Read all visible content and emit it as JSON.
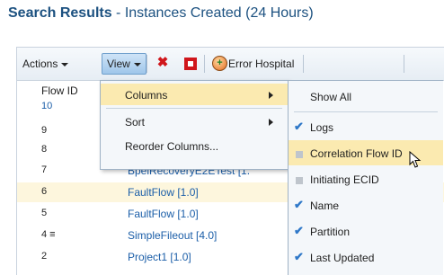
{
  "page": {
    "title_bold": "Search Results",
    "title_rest": " - Instances Created (24 Hours)"
  },
  "toolbar": {
    "actions_label": "Actions",
    "view_label": "View",
    "error_hospital_label": "Error Hospital"
  },
  "table": {
    "flow_id_header": "Flow ID",
    "rows": [
      {
        "id": "10",
        "name": ""
      },
      {
        "id": "9",
        "name": ""
      },
      {
        "id": "8",
        "name": ""
      },
      {
        "id": "7",
        "name": "BpelRecoveryE2ETest [1."
      },
      {
        "id": "6",
        "name": "FaultFlow [1.0]"
      },
      {
        "id": "5",
        "name": "FaultFlow [1.0]"
      },
      {
        "id": "4 ≡",
        "name": "SimpleFileout [4.0]"
      },
      {
        "id": "2",
        "name": "Project1 [1.0]"
      }
    ]
  },
  "view_menu": {
    "items": [
      {
        "label": "Columns",
        "has_submenu": true,
        "active": true
      },
      {
        "label": "Sort",
        "has_submenu": true,
        "active": false
      },
      {
        "label": "Reorder Columns...",
        "has_submenu": false,
        "active": false
      }
    ]
  },
  "columns_submenu": {
    "items": [
      {
        "label": "Show All",
        "checked": null
      },
      {
        "label": "Logs",
        "checked": true
      },
      {
        "label": "Correlation Flow ID",
        "checked": false
      },
      {
        "label": "Initiating ECID",
        "checked": false
      },
      {
        "label": "Name",
        "checked": true
      },
      {
        "label": "Partition",
        "checked": true
      },
      {
        "label": "Last Updated",
        "checked": true
      }
    ]
  },
  "colors": {
    "title": "#1c5180",
    "link": "#1b5ea8",
    "highlight": "#fbeab0",
    "check": "#2f78c8"
  }
}
